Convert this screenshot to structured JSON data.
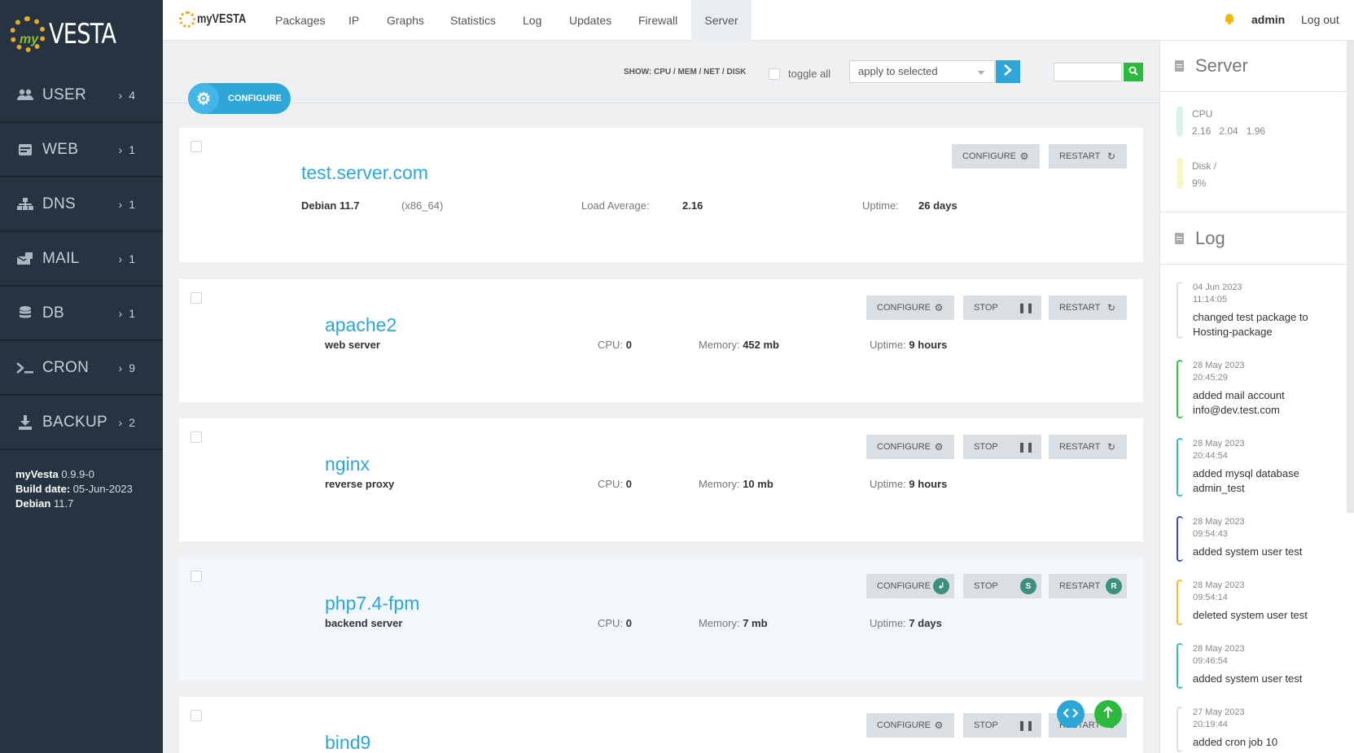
{
  "brand": {
    "logo_text": "myVESTA"
  },
  "sidebar": {
    "items": [
      {
        "label": "USER",
        "count": "4",
        "icon": "users-icon"
      },
      {
        "label": "WEB",
        "count": "1",
        "icon": "web-icon"
      },
      {
        "label": "DNS",
        "count": "1",
        "icon": "dns-icon"
      },
      {
        "label": "MAIL",
        "count": "1",
        "icon": "mail-icon"
      },
      {
        "label": "DB",
        "count": "1",
        "icon": "database-icon"
      },
      {
        "label": "CRON",
        "count": "9",
        "icon": "terminal-icon"
      },
      {
        "label": "BACKUP",
        "count": "2",
        "icon": "download-icon"
      }
    ],
    "version": {
      "name": "myVesta",
      "version": "0.9.9-0",
      "build_label": "Build date:",
      "build_date": "05-Jun-2023",
      "os_label": "Debian",
      "os_version": "11.7"
    }
  },
  "topbar": {
    "tabs": [
      "Packages",
      "IP",
      "Graphs",
      "Statistics",
      "Log",
      "Updates",
      "Firewall",
      "Server"
    ],
    "active_tab": "Server",
    "user": "admin",
    "logout": "Log out"
  },
  "toolbar": {
    "configure": "CONFIGURE",
    "show": "SHOW: CPU / MEM / NET / DISK",
    "toggle_all": "toggle all",
    "select_value": "apply to selected"
  },
  "server": {
    "hostname": "test.server.com",
    "os": "Debian 11.7",
    "arch": "(x86_64)",
    "load_label": "Load Average:",
    "load_value": "2.16",
    "uptime_label": "Uptime:",
    "uptime_value": "26 days",
    "configure": "CONFIGURE",
    "restart": "RESTART"
  },
  "services": [
    {
      "name": "apache2",
      "desc": "web server",
      "cpu": "0",
      "memory": "452 mb",
      "uptime": "9 hours"
    },
    {
      "name": "nginx",
      "desc": "reverse proxy",
      "cpu": "0",
      "memory": "10 mb",
      "uptime": "9 hours"
    },
    {
      "name": "php7.4-fpm",
      "desc": "backend server",
      "cpu": "0",
      "memory": "7 mb",
      "uptime": "7 days"
    },
    {
      "name": "bind9",
      "desc": "",
      "cpu": "",
      "memory": "",
      "uptime": ""
    }
  ],
  "service_labels": {
    "cpu": "CPU:",
    "memory": "Memory:",
    "uptime": "Uptime:",
    "configure": "CONFIGURE",
    "stop": "STOP",
    "restart": "RESTART",
    "key_configure": "↲",
    "key_stop": "S",
    "key_restart": "R"
  },
  "rpanel": {
    "server_title": "Server",
    "cpu_label": "CPU",
    "cpu_values": "2.16   2.04   1.96",
    "disk_label": "Disk /",
    "disk_value": "9%",
    "log_title": "Log",
    "log": [
      {
        "date": "04  Jun  2023",
        "time": "11:14:05",
        "text": "changed test package to Hosting-package",
        "color": "#d9dfe3"
      },
      {
        "date": "28  May  2023",
        "time": "20:45:29",
        "text": "added mail account info@dev.test.com",
        "color": "#3cbf4a"
      },
      {
        "date": "28  May  2023",
        "time": "20:44:54",
        "text": "added mysql database admin_test",
        "color": "#3fb7c9"
      },
      {
        "date": "28  May  2023",
        "time": "09:54:43",
        "text": "added system user test",
        "color": "#3a4fa8"
      },
      {
        "date": "28  May  2023",
        "time": "09:54:14",
        "text": "deleted system user test",
        "color": "#f2c230"
      },
      {
        "date": "28  May  2023",
        "time": "09:46:54",
        "text": "added system user test",
        "color": "#3fb7c9"
      },
      {
        "date": "27  May  2023",
        "time": "20:19:44",
        "text": "added cron job 10",
        "color": "#d9dfe3"
      }
    ]
  }
}
